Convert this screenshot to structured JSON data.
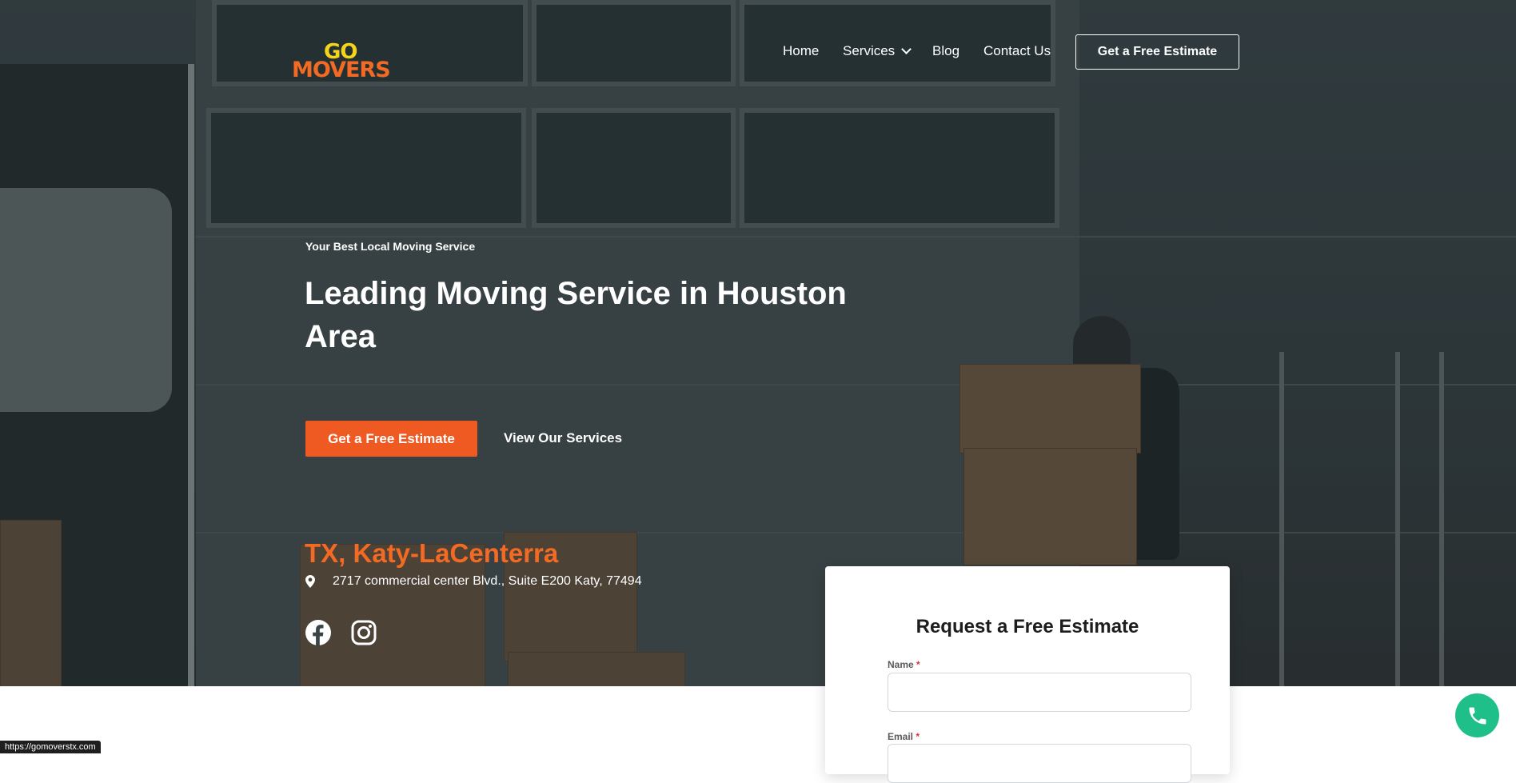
{
  "header": {
    "logo_go": "GO",
    "logo_movers": "MOVERS",
    "nav": {
      "home": "Home",
      "services": "Services",
      "blog": "Blog",
      "contact": "Contact Us"
    },
    "cta": "Get a Free Estimate"
  },
  "hero": {
    "tagline": "Your Best Local Moving Service",
    "headline": "Leading Moving Service in Houston Area",
    "primary_cta": "Get a Free Estimate",
    "secondary_cta": "View Our Services",
    "location_title": "TX, Katy-LaCenterra",
    "address": "2717 commercial center Blvd., Suite E200 Katy, 77494",
    "social": [
      "facebook-icon",
      "instagram-icon"
    ]
  },
  "form": {
    "title": "Request a Free Estimate",
    "name_label": "Name",
    "email_label": "Email",
    "required_mark": "*"
  },
  "status_bar": {
    "url": "https://gomoverstx.com"
  },
  "colors": {
    "accent": "#ef5a22",
    "logo_yellow": "#f4d51a",
    "phone_green": "#1fbf8a"
  }
}
